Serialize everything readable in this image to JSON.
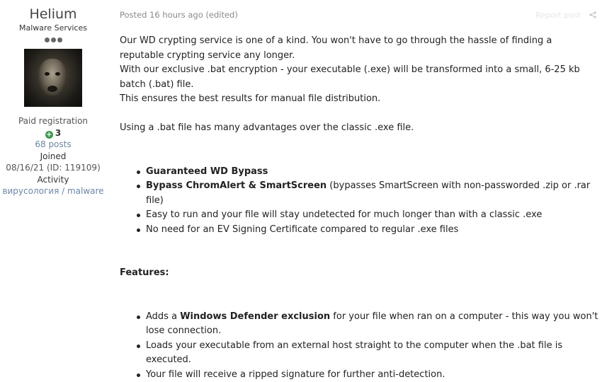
{
  "user": {
    "name": "Helium",
    "title": "Malware Services",
    "registration": "Paid registration",
    "reputation": "3",
    "posts": "68 posts",
    "joined_label": "Joined",
    "joined_value": "08/16/21 (ID: 119109)",
    "activity_label": "Activity",
    "activity_value": "вирусология / malware",
    "avatar_icon": "avatar-image"
  },
  "post": {
    "header": "Posted 16 hours ago (edited)",
    "report_link": "Report post",
    "share_icon": "share-icon",
    "intro": [
      "Our WD crypting service is one of a kind. You won't have to go through the hassle of finding a reputable crypting service any longer.",
      "With our exclusive .bat encryption - your executable (.exe) will be transformed into a small, 6-25 kb batch (.bat) file.",
      "This ensures the best results for manual file distribution."
    ],
    "advantages_intro": "Using a .bat file has many advantages over the classic .exe file.",
    "advantages": [
      {
        "bold": "Guaranteed WD Bypass",
        "rest": ""
      },
      {
        "bold": "Bypass ChromAlert & SmartScreen",
        "rest": " (bypasses SmartScreen with non-passworded .zip or .rar file)"
      },
      {
        "bold": "",
        "rest": "Easy to run and your file will stay undetected for much longer than with a classic .exe"
      },
      {
        "bold": "",
        "rest": "No need for an EV Signing Certificate compared to regular .exe files"
      }
    ],
    "features_heading": "Features:",
    "features": [
      {
        "pre": "Adds a ",
        "bold": "Windows Defender exclusion",
        "rest": " for your file when ran on a computer - this way you won't lose connection."
      },
      {
        "pre": "",
        "bold": "",
        "rest": "Loads your executable from an external host straight to the computer when the .bat file is executed."
      },
      {
        "pre": "",
        "bold": "",
        "rest": "Your file will receive a ripped signature for further anti-detection."
      }
    ]
  },
  "colors": {
    "link": "#6b86a8",
    "rep_green": "#3a9a4b",
    "muted": "#8a8a8a"
  }
}
